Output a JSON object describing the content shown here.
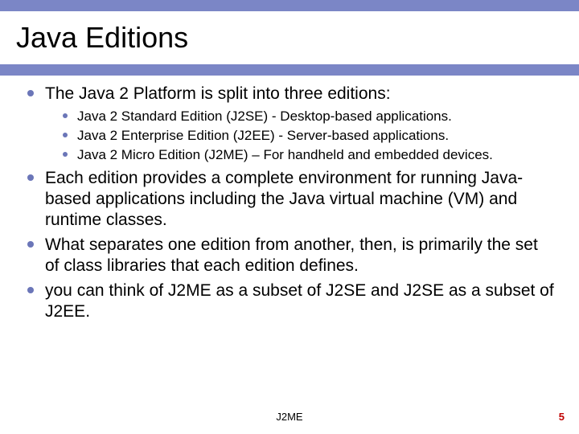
{
  "title": "Java Editions",
  "bullets": [
    {
      "text": "The Java 2 Platform is split into three editions:",
      "children": [
        "Java 2 Standard Edition (J2SE) - Desktop-based applications.",
        "Java 2 Enterprise Edition (J2EE) - Server-based applications.",
        "Java 2 Micro Edition (J2ME) – For handheld and embedded devices."
      ]
    },
    {
      "text": "Each edition provides a complete environment for running Java-based applications including the Java virtual machine (VM) and runtime classes."
    },
    {
      "text": " What separates one edition from another, then, is primarily the set of class libraries that each edition defines."
    },
    {
      "text": "you can think of J2ME as a subset of J2SE and J2SE as a subset of J2EE."
    }
  ],
  "footer": {
    "center": "J2ME",
    "page": "5"
  }
}
